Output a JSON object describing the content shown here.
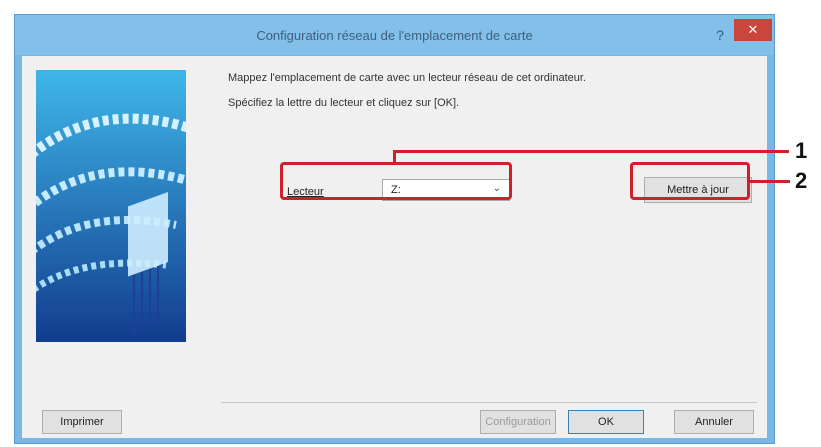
{
  "window": {
    "title": "Configuration réseau de l'emplacement de carte",
    "help_icon": "help-icon",
    "close_icon": "close-icon"
  },
  "instructions": {
    "line1": "Mappez l'emplacement de carte avec un lecteur réseau de cet ordinateur.",
    "line2": "Spécifiez la lettre du lecteur et cliquez sur [OK]."
  },
  "drive": {
    "label": "Lecteur",
    "selected": "Z:",
    "dropdown_icon": "chevron-down-icon"
  },
  "buttons": {
    "update": "Mettre à jour",
    "print": "Imprimer",
    "setup": "Configuration",
    "ok": "OK",
    "cancel": "Annuler"
  },
  "callouts": {
    "one": "1",
    "two": "2"
  },
  "colors": {
    "title_bar": "#82c0ea",
    "close": "#c9463d",
    "highlight": "#d0202a",
    "side_image": "#1d3f9a"
  }
}
